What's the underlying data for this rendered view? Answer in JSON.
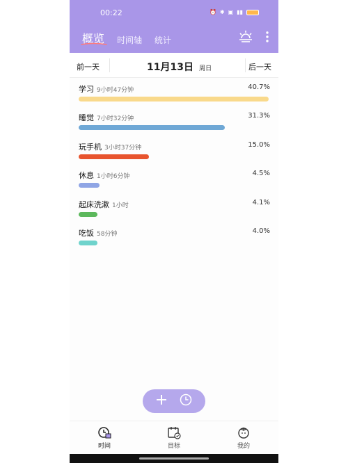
{
  "status": {
    "time": "00:22"
  },
  "colors": {
    "header": "#a996e8",
    "accent_underline": "#ff7a7a",
    "fab": "#b5a8ec"
  },
  "header": {
    "tabs": [
      {
        "label": "概览",
        "active": true
      },
      {
        "label": "时间轴",
        "active": false
      },
      {
        "label": "统计",
        "active": false
      }
    ],
    "icons": [
      "sunrise-icon",
      "more-vertical-icon"
    ]
  },
  "date_nav": {
    "prev": "前一天",
    "date": "11月13日",
    "weekday": "周日",
    "next": "后一天"
  },
  "activities": [
    {
      "name": "学习",
      "duration": "9小时47分钟",
      "percent": "40.7%",
      "color": "#f9d98b",
      "fill": 1.0
    },
    {
      "name": "睡觉",
      "duration": "7小时32分钟",
      "percent": "31.3%",
      "color": "#6fa8d6",
      "fill": 0.77
    },
    {
      "name": "玩手机",
      "duration": "3小时37分钟",
      "percent": "15.0%",
      "color": "#e8542e",
      "fill": 0.37
    },
    {
      "name": "休息",
      "duration": "1小时6分钟",
      "percent": "4.5%",
      "color": "#8fa5e5",
      "fill": 0.11
    },
    {
      "name": "起床洗漱",
      "duration": "1小时",
      "percent": "4.1%",
      "color": "#5cb85c",
      "fill": 0.1
    },
    {
      "name": "吃饭",
      "duration": "58分钟",
      "percent": "4.0%",
      "color": "#6fd3cc",
      "fill": 0.1
    }
  ],
  "fab": {
    "icons": [
      "plus-icon",
      "clock-icon"
    ]
  },
  "bottom_nav": [
    {
      "label": "时间",
      "icon": "clock-calendar-icon",
      "active": true
    },
    {
      "label": "目标",
      "icon": "goal-calendar-icon",
      "active": false
    },
    {
      "label": "我的",
      "icon": "tomato-icon",
      "active": false
    }
  ]
}
